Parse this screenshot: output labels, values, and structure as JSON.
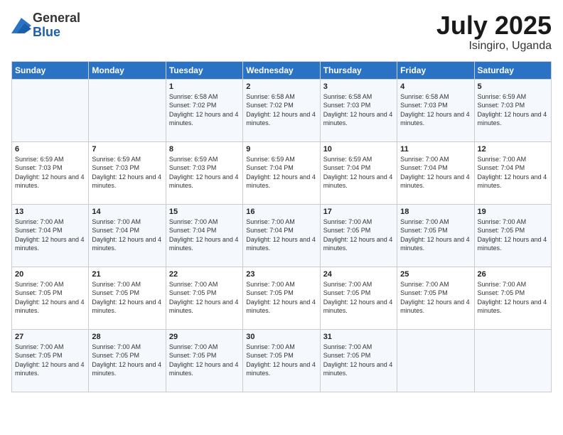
{
  "logo": {
    "general": "General",
    "blue": "Blue"
  },
  "title": {
    "month_year": "July 2025",
    "location": "Isingiro, Uganda"
  },
  "weekdays": [
    "Sunday",
    "Monday",
    "Tuesday",
    "Wednesday",
    "Thursday",
    "Friday",
    "Saturday"
  ],
  "weeks": [
    [
      {
        "day": "",
        "sunrise": "",
        "sunset": "",
        "daylight": ""
      },
      {
        "day": "",
        "sunrise": "",
        "sunset": "",
        "daylight": ""
      },
      {
        "day": "1",
        "sunrise": "Sunrise: 6:58 AM",
        "sunset": "Sunset: 7:02 PM",
        "daylight": "Daylight: 12 hours and 4 minutes."
      },
      {
        "day": "2",
        "sunrise": "Sunrise: 6:58 AM",
        "sunset": "Sunset: 7:02 PM",
        "daylight": "Daylight: 12 hours and 4 minutes."
      },
      {
        "day": "3",
        "sunrise": "Sunrise: 6:58 AM",
        "sunset": "Sunset: 7:03 PM",
        "daylight": "Daylight: 12 hours and 4 minutes."
      },
      {
        "day": "4",
        "sunrise": "Sunrise: 6:58 AM",
        "sunset": "Sunset: 7:03 PM",
        "daylight": "Daylight: 12 hours and 4 minutes."
      },
      {
        "day": "5",
        "sunrise": "Sunrise: 6:59 AM",
        "sunset": "Sunset: 7:03 PM",
        "daylight": "Daylight: 12 hours and 4 minutes."
      }
    ],
    [
      {
        "day": "6",
        "sunrise": "Sunrise: 6:59 AM",
        "sunset": "Sunset: 7:03 PM",
        "daylight": "Daylight: 12 hours and 4 minutes."
      },
      {
        "day": "7",
        "sunrise": "Sunrise: 6:59 AM",
        "sunset": "Sunset: 7:03 PM",
        "daylight": "Daylight: 12 hours and 4 minutes."
      },
      {
        "day": "8",
        "sunrise": "Sunrise: 6:59 AM",
        "sunset": "Sunset: 7:03 PM",
        "daylight": "Daylight: 12 hours and 4 minutes."
      },
      {
        "day": "9",
        "sunrise": "Sunrise: 6:59 AM",
        "sunset": "Sunset: 7:04 PM",
        "daylight": "Daylight: 12 hours and 4 minutes."
      },
      {
        "day": "10",
        "sunrise": "Sunrise: 6:59 AM",
        "sunset": "Sunset: 7:04 PM",
        "daylight": "Daylight: 12 hours and 4 minutes."
      },
      {
        "day": "11",
        "sunrise": "Sunrise: 7:00 AM",
        "sunset": "Sunset: 7:04 PM",
        "daylight": "Daylight: 12 hours and 4 minutes."
      },
      {
        "day": "12",
        "sunrise": "Sunrise: 7:00 AM",
        "sunset": "Sunset: 7:04 PM",
        "daylight": "Daylight: 12 hours and 4 minutes."
      }
    ],
    [
      {
        "day": "13",
        "sunrise": "Sunrise: 7:00 AM",
        "sunset": "Sunset: 7:04 PM",
        "daylight": "Daylight: 12 hours and 4 minutes."
      },
      {
        "day": "14",
        "sunrise": "Sunrise: 7:00 AM",
        "sunset": "Sunset: 7:04 PM",
        "daylight": "Daylight: 12 hours and 4 minutes."
      },
      {
        "day": "15",
        "sunrise": "Sunrise: 7:00 AM",
        "sunset": "Sunset: 7:04 PM",
        "daylight": "Daylight: 12 hours and 4 minutes."
      },
      {
        "day": "16",
        "sunrise": "Sunrise: 7:00 AM",
        "sunset": "Sunset: 7:04 PM",
        "daylight": "Daylight: 12 hours and 4 minutes."
      },
      {
        "day": "17",
        "sunrise": "Sunrise: 7:00 AM",
        "sunset": "Sunset: 7:05 PM",
        "daylight": "Daylight: 12 hours and 4 minutes."
      },
      {
        "day": "18",
        "sunrise": "Sunrise: 7:00 AM",
        "sunset": "Sunset: 7:05 PM",
        "daylight": "Daylight: 12 hours and 4 minutes."
      },
      {
        "day": "19",
        "sunrise": "Sunrise: 7:00 AM",
        "sunset": "Sunset: 7:05 PM",
        "daylight": "Daylight: 12 hours and 4 minutes."
      }
    ],
    [
      {
        "day": "20",
        "sunrise": "Sunrise: 7:00 AM",
        "sunset": "Sunset: 7:05 PM",
        "daylight": "Daylight: 12 hours and 4 minutes."
      },
      {
        "day": "21",
        "sunrise": "Sunrise: 7:00 AM",
        "sunset": "Sunset: 7:05 PM",
        "daylight": "Daylight: 12 hours and 4 minutes."
      },
      {
        "day": "22",
        "sunrise": "Sunrise: 7:00 AM",
        "sunset": "Sunset: 7:05 PM",
        "daylight": "Daylight: 12 hours and 4 minutes."
      },
      {
        "day": "23",
        "sunrise": "Sunrise: 7:00 AM",
        "sunset": "Sunset: 7:05 PM",
        "daylight": "Daylight: 12 hours and 4 minutes."
      },
      {
        "day": "24",
        "sunrise": "Sunrise: 7:00 AM",
        "sunset": "Sunset: 7:05 PM",
        "daylight": "Daylight: 12 hours and 4 minutes."
      },
      {
        "day": "25",
        "sunrise": "Sunrise: 7:00 AM",
        "sunset": "Sunset: 7:05 PM",
        "daylight": "Daylight: 12 hours and 4 minutes."
      },
      {
        "day": "26",
        "sunrise": "Sunrise: 7:00 AM",
        "sunset": "Sunset: 7:05 PM",
        "daylight": "Daylight: 12 hours and 4 minutes."
      }
    ],
    [
      {
        "day": "27",
        "sunrise": "Sunrise: 7:00 AM",
        "sunset": "Sunset: 7:05 PM",
        "daylight": "Daylight: 12 hours and 4 minutes."
      },
      {
        "day": "28",
        "sunrise": "Sunrise: 7:00 AM",
        "sunset": "Sunset: 7:05 PM",
        "daylight": "Daylight: 12 hours and 4 minutes."
      },
      {
        "day": "29",
        "sunrise": "Sunrise: 7:00 AM",
        "sunset": "Sunset: 7:05 PM",
        "daylight": "Daylight: 12 hours and 4 minutes."
      },
      {
        "day": "30",
        "sunrise": "Sunrise: 7:00 AM",
        "sunset": "Sunset: 7:05 PM",
        "daylight": "Daylight: 12 hours and 4 minutes."
      },
      {
        "day": "31",
        "sunrise": "Sunrise: 7:00 AM",
        "sunset": "Sunset: 7:05 PM",
        "daylight": "Daylight: 12 hours and 4 minutes."
      },
      {
        "day": "",
        "sunrise": "",
        "sunset": "",
        "daylight": ""
      },
      {
        "day": "",
        "sunrise": "",
        "sunset": "",
        "daylight": ""
      }
    ]
  ]
}
